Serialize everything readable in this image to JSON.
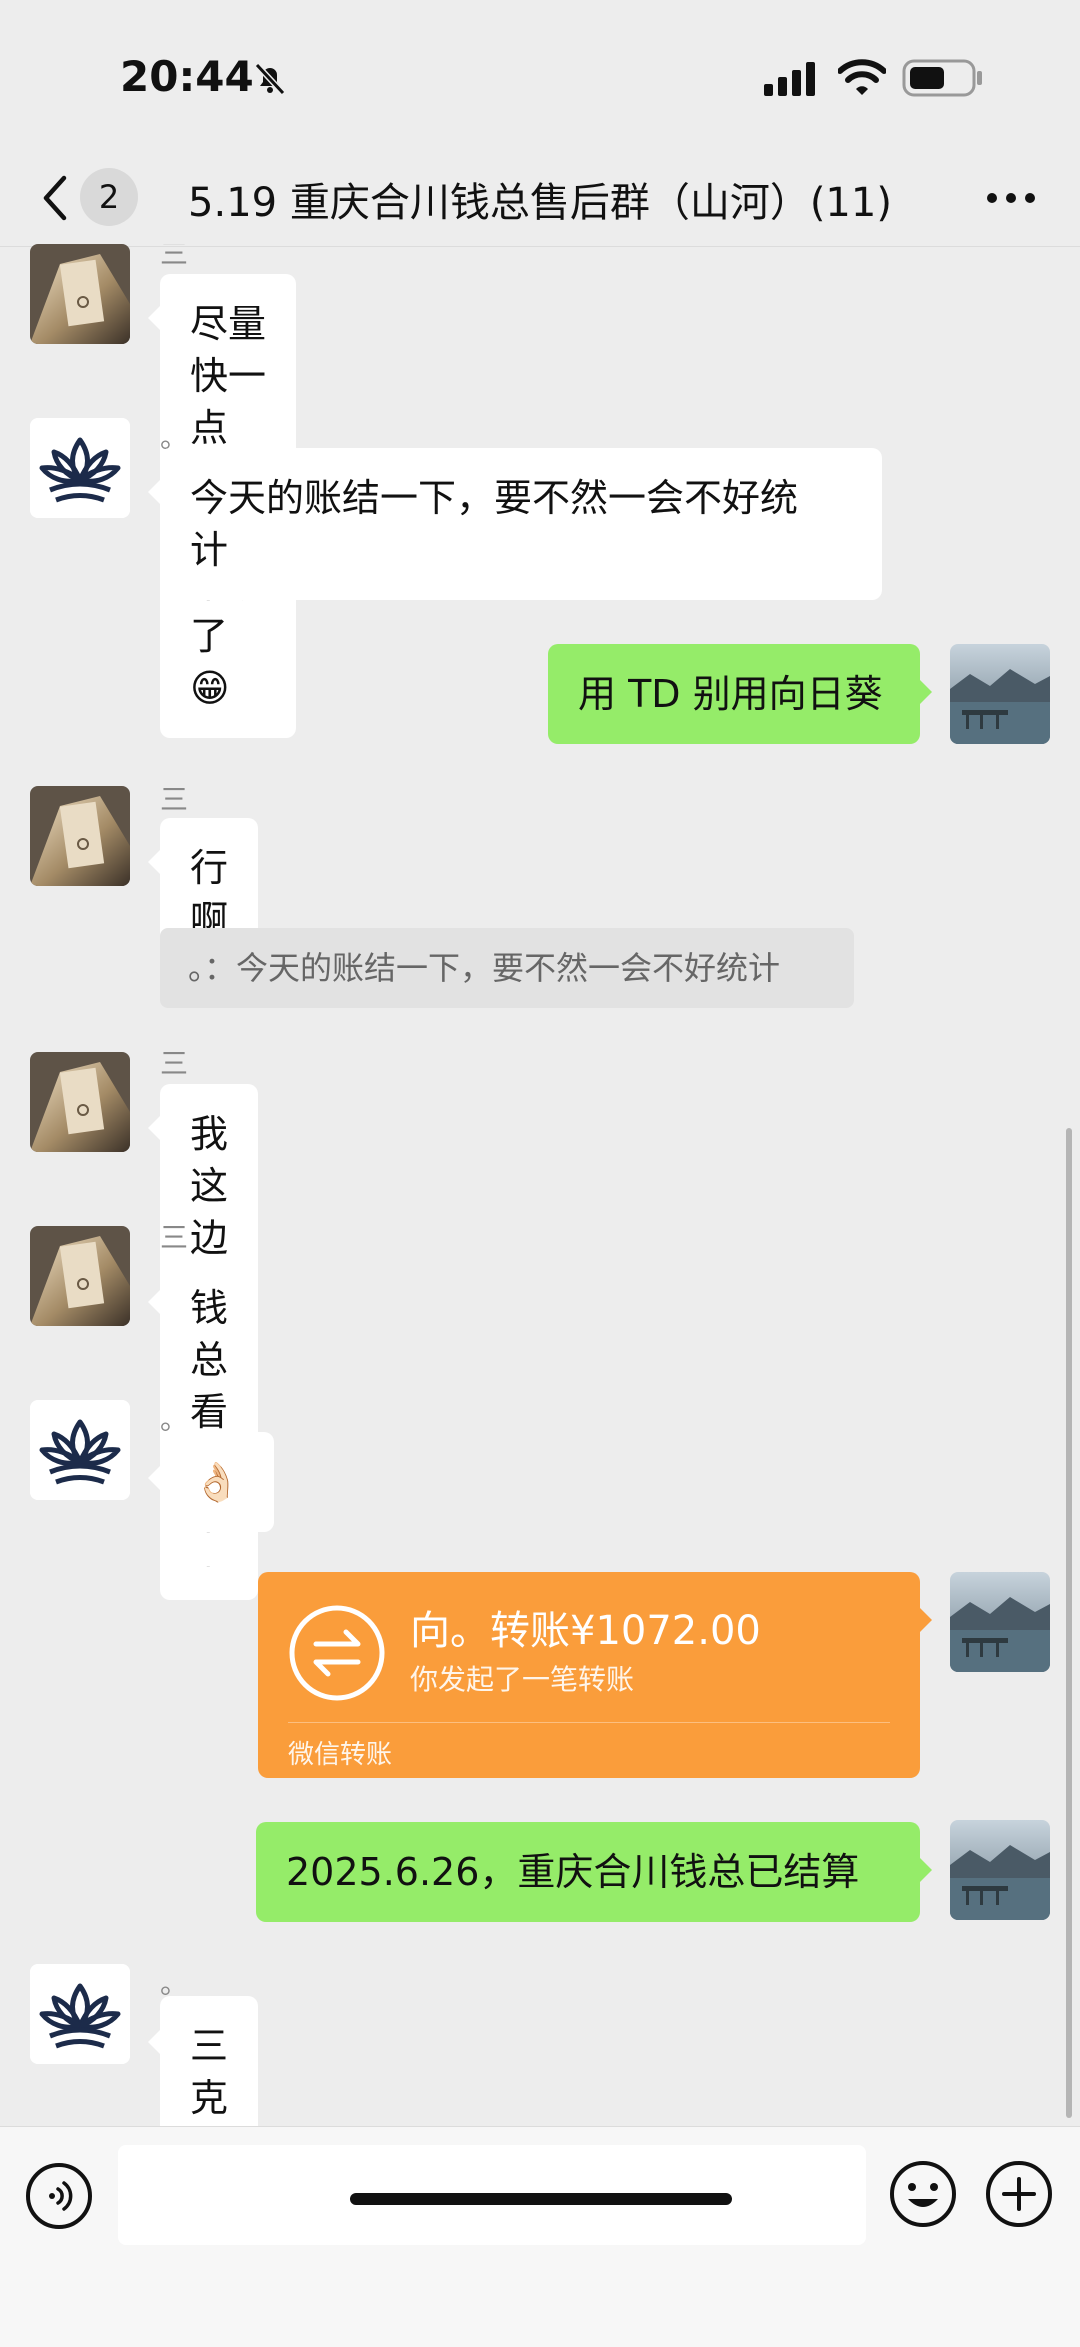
{
  "status_bar": {
    "time": "20:44"
  },
  "header": {
    "unread_count": "2",
    "title": "5.19 重庆合川钱总售后群（山河）(11)"
  },
  "messages": [
    {
      "sender": "三秋",
      "text": "尽量快一点吧，一会下班了😁"
    },
    {
      "sender": "。",
      "line1": "今天的账结一下，要不然一会不好统",
      "line2": "计"
    },
    {
      "text": "用 TD 别用向日葵"
    },
    {
      "sender": "三秋",
      "text": "行啊",
      "quote": "。：今天的账结一下，要不然一会不好统计"
    },
    {
      "sender": "三秋",
      "text": "我这边给你统计一下"
    },
    {
      "sender": "三秋",
      "text": "钱总看一下"
    },
    {
      "sender": "。",
      "text": "👌🏻"
    },
    {
      "transfer": {
        "title": "向。转账¥1072.00",
        "subtitle": "你发起了一笔转账",
        "footer": "微信转账"
      }
    },
    {
      "text": "2025.6.26，重庆合川钱总已结算"
    },
    {
      "sender": "。",
      "text": "三克油"
    }
  ],
  "icons": {
    "mute": "bell-slash-icon",
    "signal": "signal-icon",
    "wifi": "wifi-icon",
    "battery": "battery-icon",
    "back": "chevron-left-icon",
    "more": "more-dots-icon",
    "voice": "voice-icon",
    "emoji": "emoji-icon",
    "plus": "plus-icon",
    "transfer": "transfer-arrows-icon",
    "lotus": "lotus-avatar",
    "landscape": "lake-avatar"
  },
  "colors": {
    "background": "#ededed",
    "sent_bubble": "#95ec69",
    "received_bubble": "#ffffff",
    "transfer_card": "#fa9d3b"
  }
}
